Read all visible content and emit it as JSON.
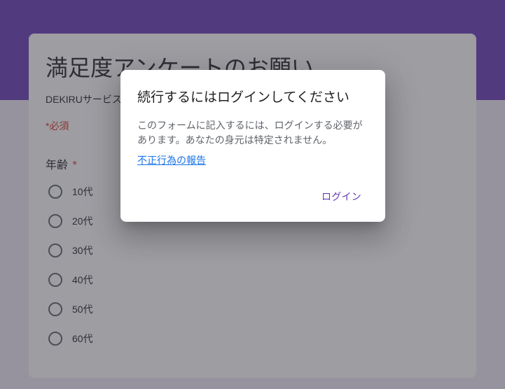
{
  "form": {
    "title": "満足度アンケートのお願い",
    "description": "DEKIRUサービス",
    "required_note": "*必須",
    "question": {
      "title": "年齢",
      "required_mark": "*",
      "options": [
        "10代",
        "20代",
        "30代",
        "40代",
        "50代",
        "60代"
      ]
    }
  },
  "dialog": {
    "title": "続行するにはログインしてください",
    "body": "このフォームに記入するには、ログインする必要があります。あなたの身元は特定されません。",
    "report_link": "不正行為の報告",
    "login_button": "ログイン"
  }
}
